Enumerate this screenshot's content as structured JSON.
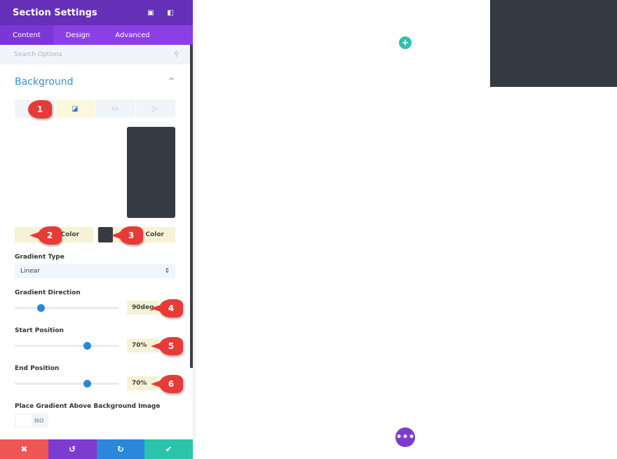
{
  "header": {
    "title": "Section Settings",
    "icons": [
      "expand-icon",
      "sidebar-toggle-icon"
    ]
  },
  "tabs": [
    {
      "label": "Content",
      "active": true
    },
    {
      "label": "Design"
    },
    {
      "label": "Advanced"
    }
  ],
  "search": {
    "placeholder": "Search Options"
  },
  "section": {
    "title": "Background",
    "chevron": "^"
  },
  "background_types": [
    "color-icon",
    "gradient-icon",
    "image-icon",
    "video-icon"
  ],
  "preview_color": "#353b42",
  "colors": {
    "start_label": "t Color",
    "end_label": "t Color",
    "end_swatch": "#353b42"
  },
  "gradient_type": {
    "label": "Gradient Type",
    "value": "Linear"
  },
  "gradient_direction": {
    "label": "Gradient Direction",
    "value": "90deg",
    "slider_percent": 25
  },
  "start_position": {
    "label": "Start Position",
    "value": "70%",
    "slider_percent": 70
  },
  "end_position": {
    "label": "End Position",
    "value": "70%",
    "slider_percent": 70
  },
  "place_above": {
    "label": "Place Gradient Above Background Image",
    "value": "NO"
  },
  "markers": [
    "1",
    "2",
    "3",
    "4",
    "5",
    "6"
  ],
  "footer": {
    "cancel": "✖",
    "undo": "↺",
    "redo": "↻",
    "save": "✔"
  },
  "canvas": {
    "add": "+",
    "more": "•••"
  }
}
